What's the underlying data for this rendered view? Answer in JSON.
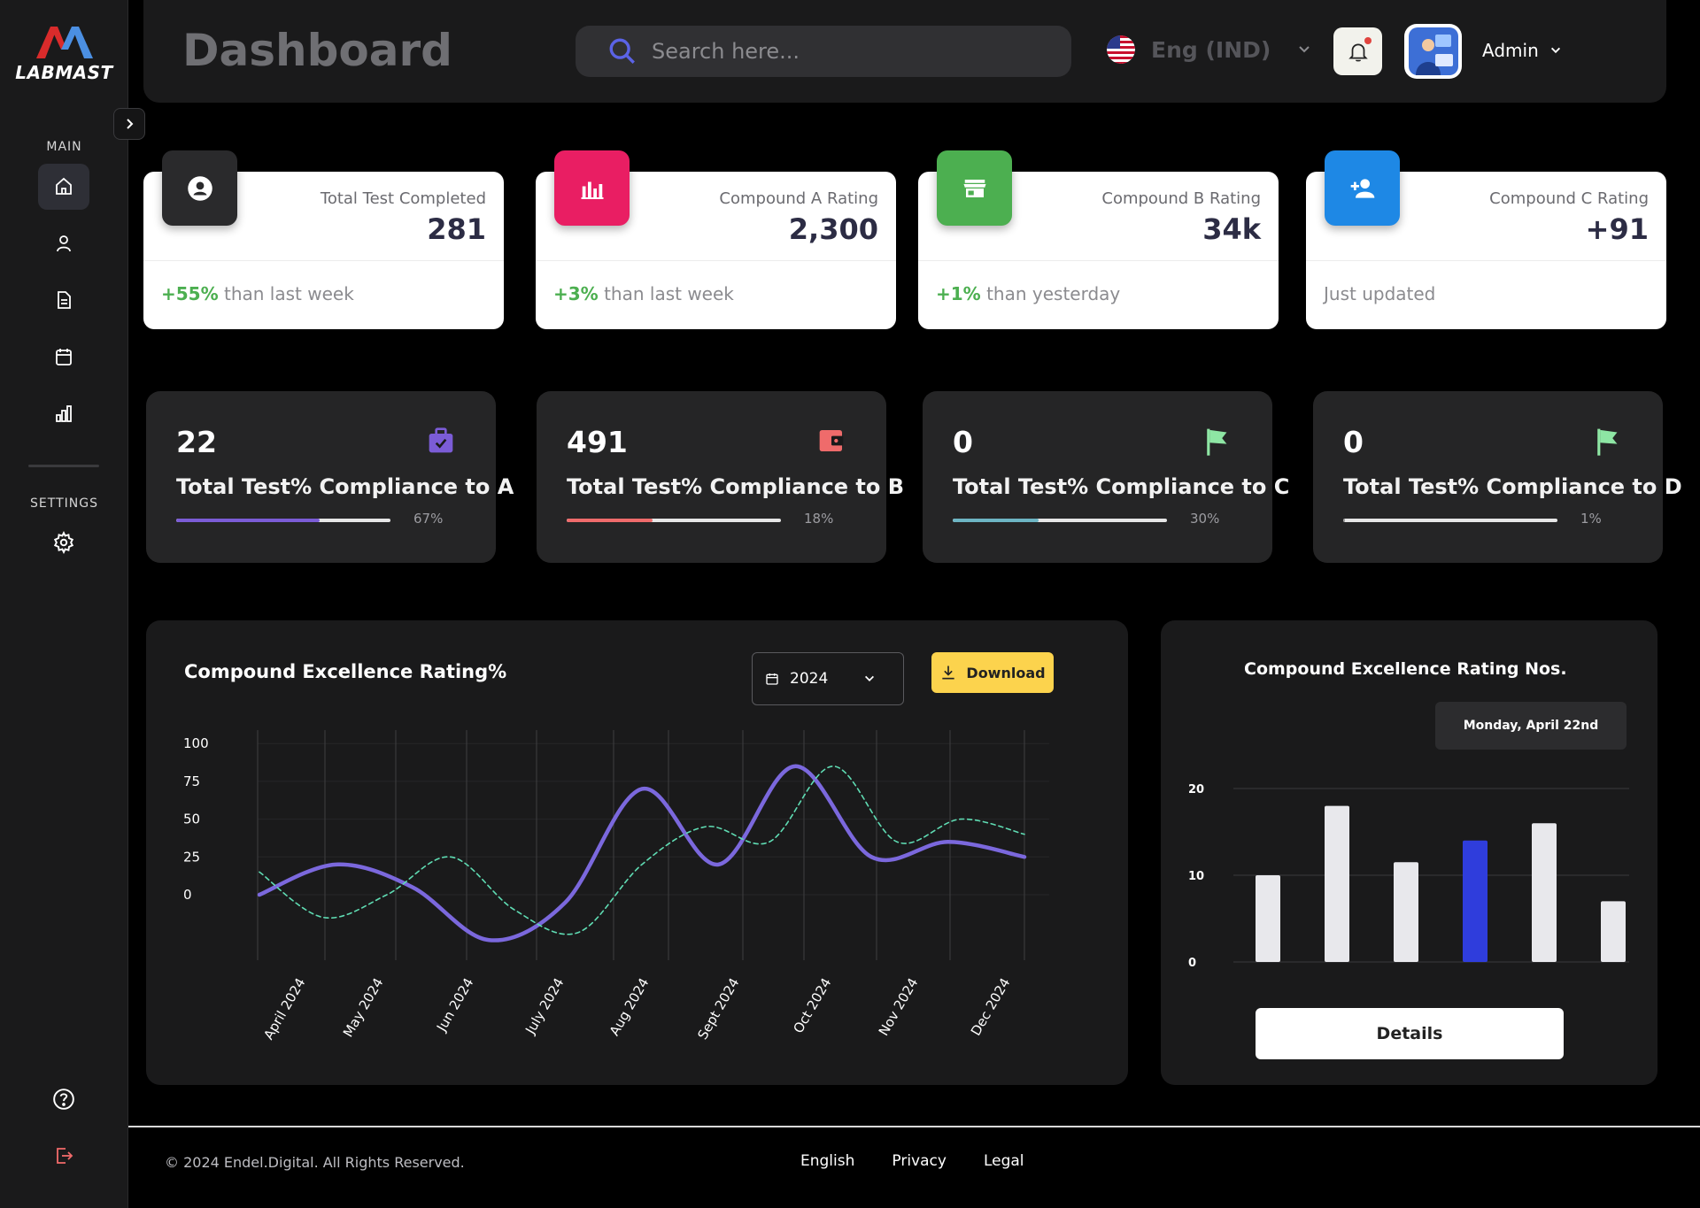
{
  "brand": {
    "name": "LABMAST"
  },
  "sidebar": {
    "main_label": "MAIN",
    "settings_label": "SETTINGS",
    "items": [
      {
        "icon": "home-icon",
        "active": true
      },
      {
        "icon": "user-icon",
        "active": false
      },
      {
        "icon": "document-icon",
        "active": false
      },
      {
        "icon": "calendar-icon",
        "active": false
      },
      {
        "icon": "chart-icon",
        "active": false
      }
    ],
    "settings_icon": "gear-icon",
    "help_icon": "help-icon",
    "logout_icon": "logout-icon"
  },
  "header": {
    "title": "Dashboard",
    "search_placeholder": "Search here...",
    "language": "Eng (IND)",
    "user": "Admin"
  },
  "stats": [
    {
      "label": "Total Test Completed",
      "value": "281",
      "change": "+55%",
      "note": " than last week",
      "icon": "person-icon",
      "icon_bg": "#2a2a2c"
    },
    {
      "label": "Compound A Rating",
      "value": "2,300",
      "change": "+3%",
      "note": " than last week",
      "icon": "bar-chart-icon",
      "icon_bg": "#e91e63"
    },
    {
      "label": "Compound B Rating",
      "value": "34k",
      "change": "+1%",
      "note": " than yesterday",
      "icon": "store-icon",
      "icon_bg": "#4caf50"
    },
    {
      "label": "Compound C Rating",
      "value": "+91",
      "change": "",
      "note": "Just updated",
      "icon": "add-user-icon",
      "icon_bg": "#1e88e5"
    }
  ],
  "compliance": [
    {
      "value": "22",
      "label": "Total Test% Compliance to A",
      "percent": "67%",
      "fraction": 0.67,
      "color": "#7b5cd6",
      "icon": "briefcase-check-icon",
      "icon_color": "#7b5cd6"
    },
    {
      "value": "491",
      "label": "Total Test% Compliance to B",
      "percent": "18%",
      "fraction": 0.4,
      "color": "#ef6b6b",
      "icon": "wallet-icon",
      "icon_color": "#ef6b6b"
    },
    {
      "value": "0",
      "label": "Total Test% Compliance to C",
      "percent": "30%",
      "fraction": 0.4,
      "color": "#6db5c3",
      "icon": "flag-icon",
      "icon_color": "#8ee6a4"
    },
    {
      "value": "0",
      "label": "Total Test% Compliance to D",
      "percent": "1%",
      "fraction": 0.01,
      "color": "#9a9a9a",
      "icon": "flag-icon",
      "icon_color": "#8ee6a4"
    }
  ],
  "line_panel": {
    "title": "Compound Excellence Rating%",
    "year": "2024",
    "download_label": "Download"
  },
  "bar_panel": {
    "title": "Compound Excellence Rating Nos.",
    "date": "Monday, April 22nd",
    "details_label": "Details"
  },
  "footer": {
    "copyright": "© 2024 Endel.Digital. All Rights Reserved.",
    "links": [
      "English",
      "Privacy",
      "Legal"
    ]
  },
  "chart_data": [
    {
      "type": "line",
      "title": "Compound Excellence Rating%",
      "x": [
        "April 2024",
        "May 2024",
        "Jun 2024",
        "July 2024",
        "Aug 2024",
        "Sept 2024",
        "Oct 2024",
        "Nov 2024",
        "Dec 2024"
      ],
      "ylim": [
        0,
        100
      ],
      "yticks": [
        100,
        75,
        50,
        25,
        0
      ],
      "series": [
        {
          "style": "solid",
          "color": "#7b68dd",
          "values": [
            0,
            20,
            5,
            -30,
            -5,
            70,
            20,
            85,
            25,
            35,
            25
          ]
        },
        {
          "style": "dashed",
          "color": "#5fdcb3",
          "values": [
            15,
            -15,
            0,
            25,
            -10,
            -25,
            20,
            45,
            35,
            85,
            35,
            50,
            40
          ]
        }
      ]
    },
    {
      "type": "bar",
      "title": "Compound Excellence Rating Nos.",
      "ylim": [
        0,
        20
      ],
      "yticks": [
        20,
        10,
        0
      ],
      "values": [
        10,
        18,
        11.5,
        14,
        16,
        7
      ],
      "colors": [
        "#e8e8ec",
        "#e8e8ec",
        "#e8e8ec",
        "#2f3ddc",
        "#e8e8ec",
        "#e8e8ec"
      ]
    }
  ]
}
